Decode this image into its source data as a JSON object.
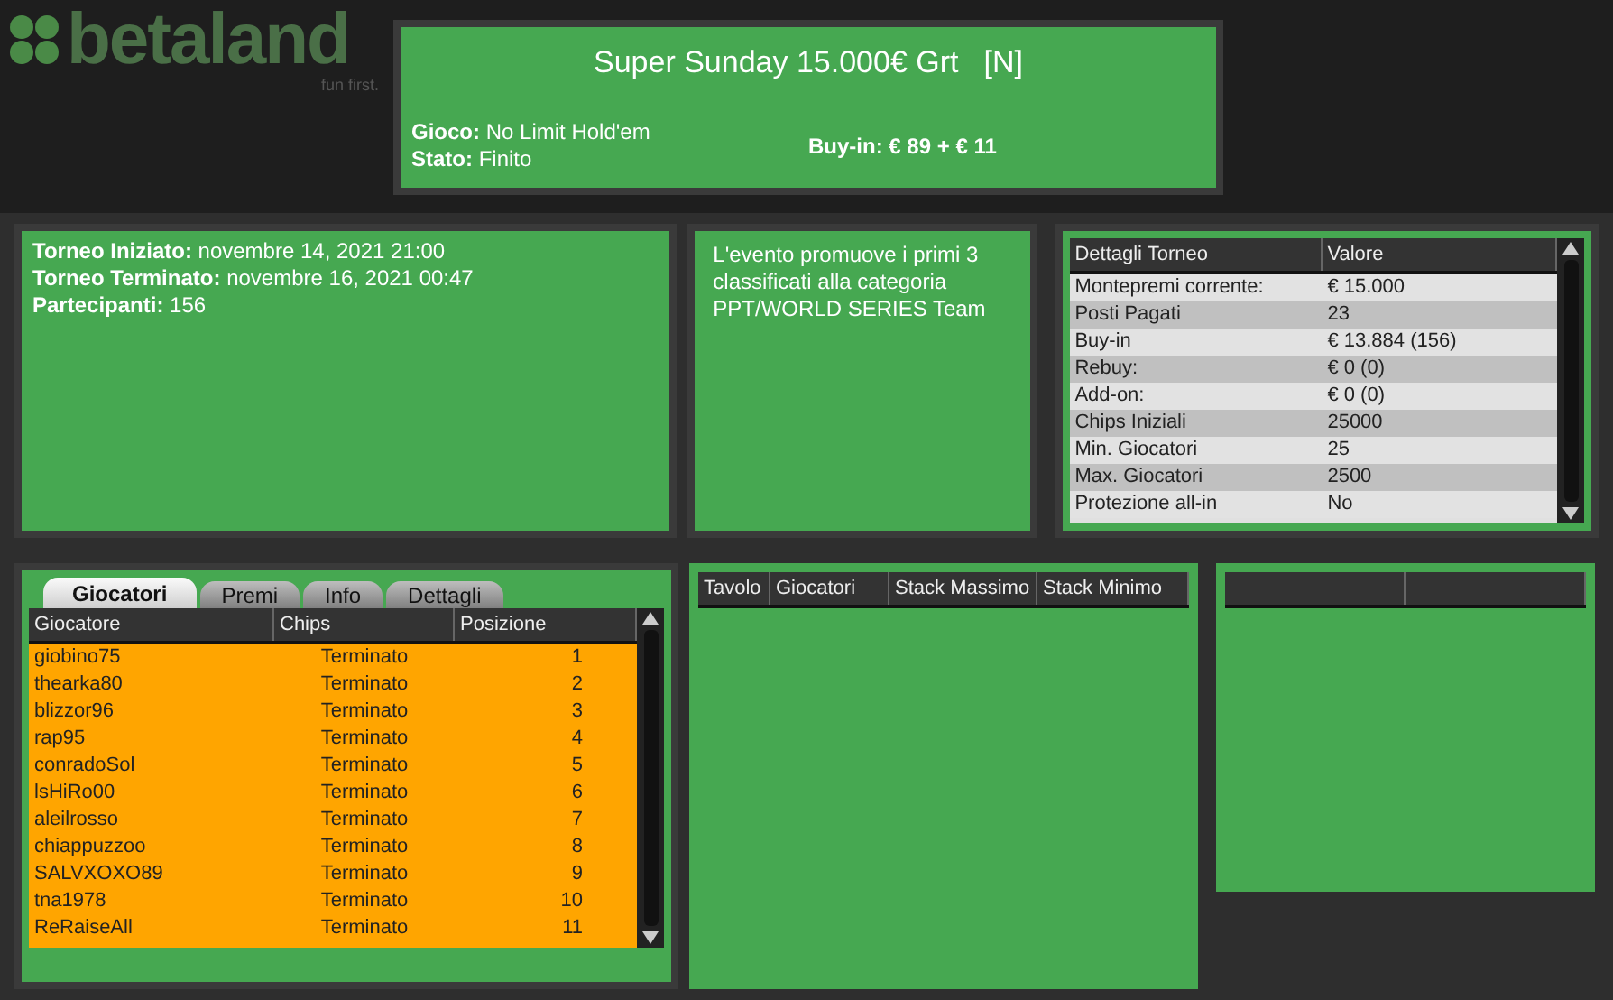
{
  "logo": {
    "name": "betaland",
    "tagline": "fun first."
  },
  "header": {
    "title": "Super Sunday 15.000€ Grt",
    "tag": "[N]",
    "fields": [
      {
        "label": "Gioco:",
        "value": "No Limit Hold'em"
      },
      {
        "label": "Stato:",
        "value": "Finito"
      }
    ],
    "buy_in": "Buy-in: € 89 + € 11"
  },
  "summary": [
    {
      "label": "Torneo Iniziato:",
      "value": "novembre 14, 2021 21:00"
    },
    {
      "label": "Torneo Terminato:",
      "value": "novembre 16, 2021 00:47"
    },
    {
      "label": "Partecipanti:",
      "value": "156"
    }
  ],
  "description": "L'evento promuove i primi 3 classificati alla categoria PPT/WORLD SERIES Team",
  "details": {
    "columns": [
      "Dettagli Torneo",
      "Valore"
    ],
    "rows": [
      [
        "Montepremi corrente:",
        "€ 15.000"
      ],
      [
        "Posti Pagati",
        "23"
      ],
      [
        "Buy-in",
        "€ 13.884 (156)"
      ],
      [
        "Rebuy:",
        "€ 0 (0)"
      ],
      [
        "Add-on:",
        "€ 0 (0)"
      ],
      [
        "Chips Iniziali",
        "25000"
      ],
      [
        "Min. Giocatori",
        "25"
      ],
      [
        "Max. Giocatori",
        "2500"
      ],
      [
        "Protezione all-in",
        "No"
      ]
    ]
  },
  "tabs": [
    {
      "label": "Giocatori",
      "selected": true
    },
    {
      "label": "Premi",
      "selected": false
    },
    {
      "label": "Info",
      "selected": false
    },
    {
      "label": "Dettagli",
      "selected": false
    }
  ],
  "players": {
    "columns": [
      "Giocatore",
      "Chips",
      "Posizione"
    ],
    "rows": [
      [
        "giobino75",
        "Terminato",
        "1"
      ],
      [
        "thearka80",
        "Terminato",
        "2"
      ],
      [
        "blizzor96",
        "Terminato",
        "3"
      ],
      [
        "rap95",
        "Terminato",
        "4"
      ],
      [
        "conradoSol",
        "Terminato",
        "5"
      ],
      [
        "lsHiRo00",
        "Terminato",
        "6"
      ],
      [
        "aleilrosso",
        "Terminato",
        "7"
      ],
      [
        "chiappuzzoo",
        "Terminato",
        "8"
      ],
      [
        "SALVXOXO89",
        "Terminato",
        "9"
      ],
      [
        "tna1978",
        "Terminato",
        "10"
      ],
      [
        "ReRaiseAll",
        "Terminato",
        "11"
      ]
    ]
  },
  "tables": {
    "columns": [
      "Tavolo",
      "Giocatori",
      "Stack Massimo",
      "Stack Minimo"
    ]
  }
}
